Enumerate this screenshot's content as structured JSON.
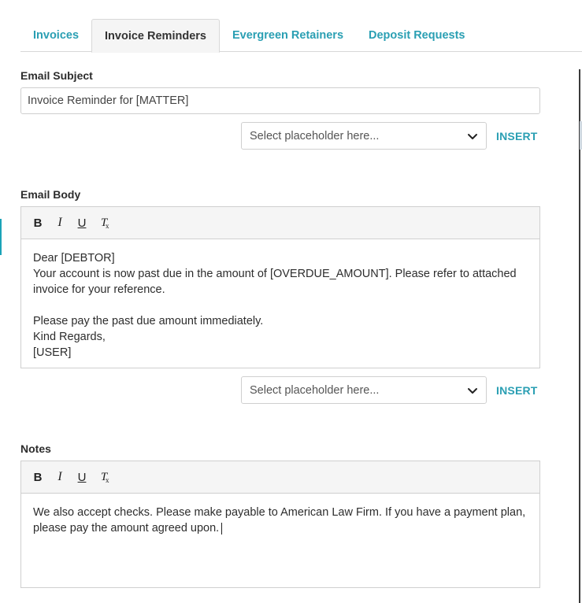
{
  "tabs": [
    {
      "label": "Invoices",
      "active": false
    },
    {
      "label": "Invoice Reminders",
      "active": true
    },
    {
      "label": "Evergreen Retainers",
      "active": false
    },
    {
      "label": "Deposit Requests",
      "active": false
    }
  ],
  "subject": {
    "label": "Email Subject",
    "value": "Invoice Reminder for [MATTER]"
  },
  "placeholder_selector": {
    "placeholder": "Select placeholder here...",
    "insert_label": "INSERT"
  },
  "body": {
    "label": "Email Body",
    "lines": [
      "Dear [DEBTOR]",
      "Your account is now past due in the amount of [OVERDUE_AMOUNT]. Please refer to attached invoice for your reference.",
      "",
      "Please pay the past due amount immediately.",
      "Kind Regards,",
      "[USER]"
    ]
  },
  "notes": {
    "label": "Notes",
    "text": "We also accept checks. Please make payable to American Law Firm. If you have a payment plan, please pay the amount agreed upon."
  },
  "toolbar": {
    "bold": "B",
    "italic": "I",
    "underline": "U",
    "clear_format": "T",
    "clear_format_sub": "x"
  },
  "icons": {
    "dropdown": "chevron-down-icon"
  },
  "colors": {
    "accent": "#2a9fb3",
    "border": "#cfcfcf",
    "toolbar_bg": "#f5f5f5"
  }
}
